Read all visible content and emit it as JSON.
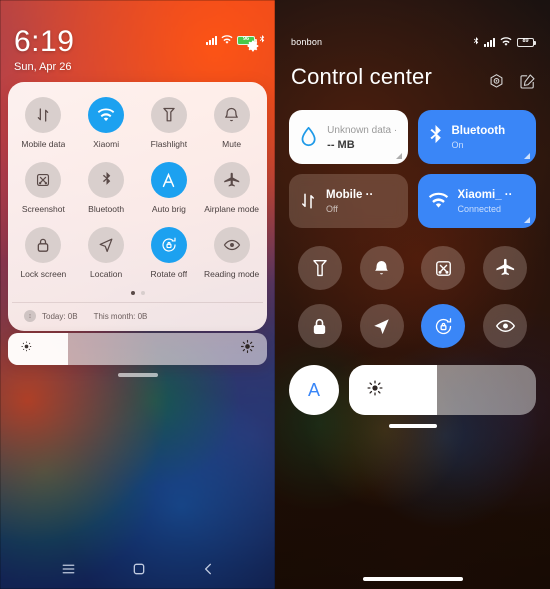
{
  "left": {
    "status": {
      "time": "6:19",
      "date": "Sun, Apr 26",
      "battery_level": "96"
    },
    "quick_settings": {
      "tiles": [
        {
          "label": "Mobile data",
          "icon": "mobile-data-icon",
          "active": false
        },
        {
          "label": "Xiaomi",
          "icon": "wifi-icon",
          "active": true
        },
        {
          "label": "Flashlight",
          "icon": "flashlight-icon",
          "active": false
        },
        {
          "label": "Mute",
          "icon": "bell-icon",
          "active": false
        },
        {
          "label": "Screenshot",
          "icon": "screenshot-icon",
          "active": false
        },
        {
          "label": "Bluetooth",
          "icon": "bluetooth-icon",
          "active": false
        },
        {
          "label": "Auto brig",
          "icon": "auto-brightness-icon",
          "active": true
        },
        {
          "label": "Airplane mode",
          "icon": "airplane-icon",
          "active": false
        },
        {
          "label": "Lock screen",
          "icon": "lock-icon",
          "active": false
        },
        {
          "label": "Location",
          "icon": "location-icon",
          "active": false
        },
        {
          "label": "Rotate off",
          "icon": "rotate-lock-icon",
          "active": true
        },
        {
          "label": "Reading mode",
          "icon": "eye-icon",
          "active": false
        }
      ],
      "page_dots": 2,
      "active_dot": 0,
      "footer": {
        "today": "Today: 0B",
        "this_month": "This month: 0B"
      }
    },
    "brightness": {
      "value_percent": 23,
      "low_icon": "brightness-low-icon",
      "high_icon": "brightness-high-icon"
    },
    "nav_bar": [
      {
        "name": "menu-button",
        "icon": "menu-icon"
      },
      {
        "name": "home-button",
        "icon": "home-square-icon"
      },
      {
        "name": "back-button",
        "icon": "chevron-left-icon"
      }
    ]
  },
  "right": {
    "status": {
      "carrier": "bonbon",
      "battery_level": "89"
    },
    "header": {
      "title": "Control center",
      "settings_icon": "settings-hex-icon",
      "edit_icon": "edit-square-icon"
    },
    "tiles": [
      {
        "name": "data-usage-tile",
        "title": "Unknown data ··",
        "subtitle": "-- MB",
        "icon": "water-drop-icon",
        "style": "white",
        "expandable": true
      },
      {
        "name": "bluetooth-tile",
        "title": "Bluetooth",
        "subtitle": "On",
        "icon": "bluetooth-icon",
        "style": "blue",
        "expandable": true
      },
      {
        "name": "mobile-data-tile",
        "title": "Mobile ··",
        "subtitle": "Off",
        "icon": "mobile-data-icon",
        "style": "dim",
        "expandable": false
      },
      {
        "name": "wifi-tile",
        "title": "Xiaomi_ ··",
        "subtitle": "Connected",
        "icon": "wifi-icon",
        "style": "blue",
        "expandable": true
      }
    ],
    "circle_toggles": [
      {
        "name": "flashlight-toggle",
        "icon": "flashlight-icon",
        "active": false
      },
      {
        "name": "mute-toggle",
        "icon": "bell-icon",
        "active": false
      },
      {
        "name": "screenshot-toggle",
        "icon": "screenshot-icon",
        "active": false
      },
      {
        "name": "airplane-toggle",
        "icon": "airplane-icon",
        "active": false
      },
      {
        "name": "lock-screen-toggle",
        "icon": "lock-icon",
        "active": false
      },
      {
        "name": "location-toggle",
        "icon": "location-icon",
        "active": false
      },
      {
        "name": "rotate-lock-toggle",
        "icon": "rotate-lock-icon",
        "active": true
      },
      {
        "name": "reading-mode-toggle",
        "icon": "eye-icon",
        "active": false
      }
    ],
    "brightness": {
      "auto_label": "A",
      "value_percent": 47,
      "icon": "brightness-high-icon"
    }
  },
  "colors": {
    "accent_blue": "#3a86f7",
    "tile_blue": "#1ca1f0",
    "battery_green": "#48c94b"
  }
}
